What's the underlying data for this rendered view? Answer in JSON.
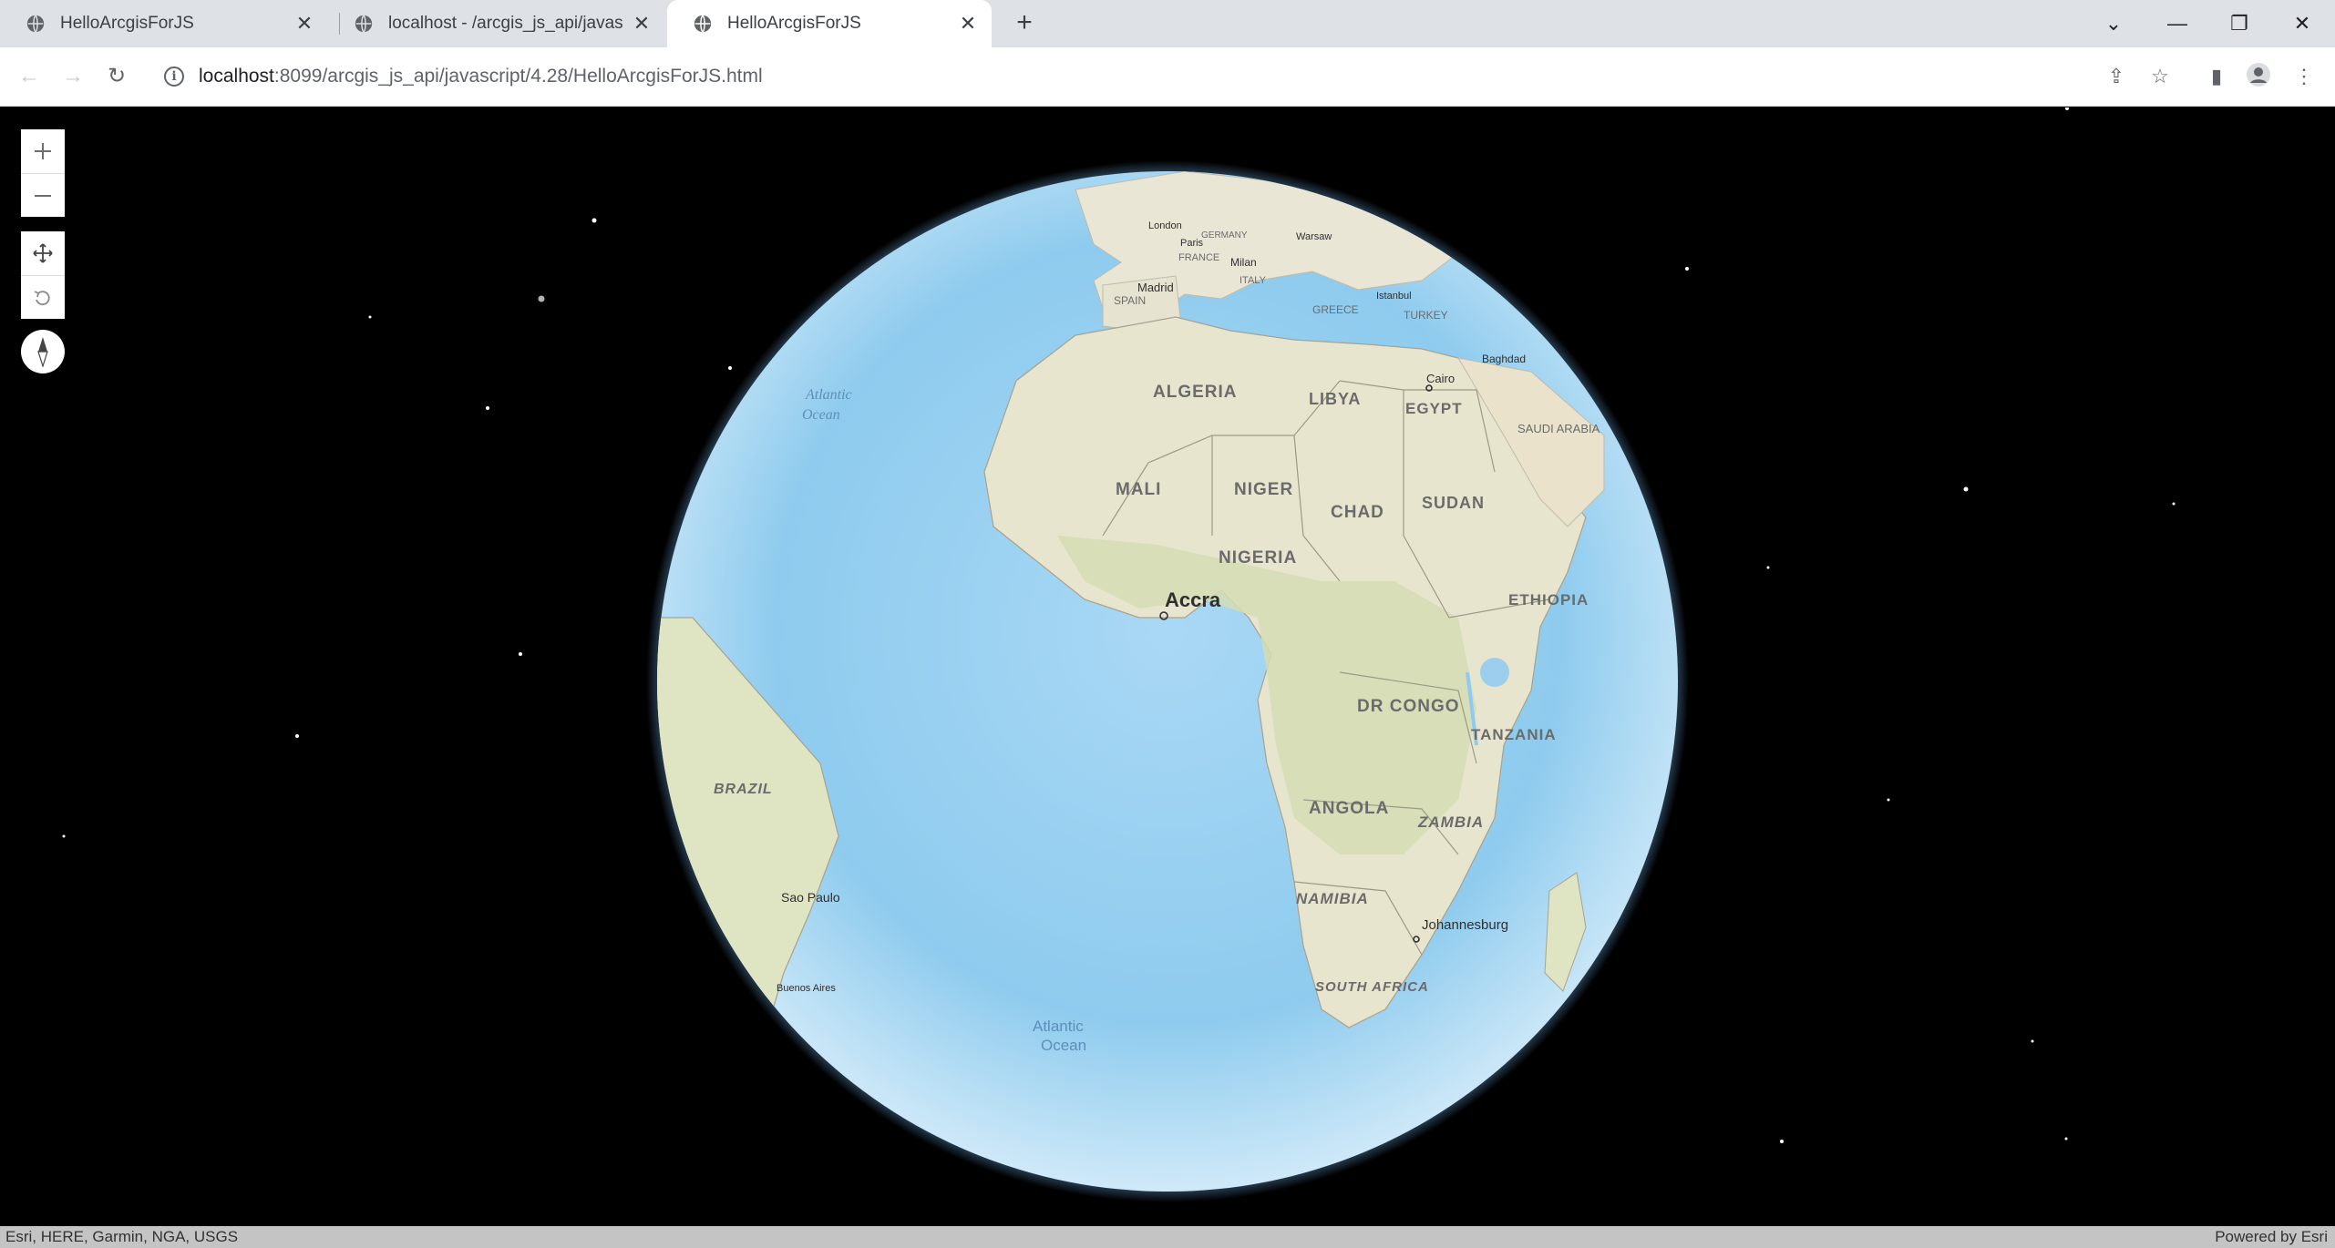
{
  "browser": {
    "tabs": [
      {
        "title": "HelloArcgisForJS",
        "active": false
      },
      {
        "title": "localhost - /arcgis_js_api/javas",
        "active": false
      },
      {
        "title": "HelloArcgisForJS",
        "active": true
      }
    ],
    "url_host": "localhost",
    "url_rest": ":8099/arcgis_js_api/javascript/4.28/HelloArcgisForJS.html"
  },
  "map": {
    "labels": {
      "algeria": "ALGERIA",
      "libya": "LIBYA",
      "egypt": "EGYPT",
      "mali": "MALI",
      "niger": "NIGER",
      "chad": "CHAD",
      "sudan": "SUDAN",
      "nigeria": "NIGERIA",
      "ethiopia": "ETHIOPIA",
      "accra": "Accra",
      "dr_congo": "DR CONGO",
      "tanzania": "TANZANIA",
      "angola": "ANGOLA",
      "zambia": "ZAMBIA",
      "namibia": "NAMIBIA",
      "johannesburg": "Johannesburg",
      "south_africa": "SOUTH AFRICA",
      "brazil": "BRAZIL",
      "sao_paulo": "Sao Paulo",
      "buenos_aires": "Buenos Aires",
      "atlantic_n_1": "Atlantic",
      "atlantic_n_2": "Ocean",
      "atlantic_s_1": "Atlantic",
      "atlantic_s_2": "Ocean",
      "madrid": "Madrid",
      "spain": "SPAIN",
      "france": "FRANCE",
      "italy": "ITALY",
      "milan": "Milan",
      "greece": "GREECE",
      "turkey": "TURKEY",
      "cairo": "Cairo",
      "saudi_arabia": "SAUDI ARABIA",
      "baghdad": "Baghdad",
      "paris": "Paris",
      "london": "London",
      "germany": "GERMANY",
      "warsaw": "Warsaw",
      "istanbul": "Istanbul"
    },
    "attribution": "Esri, HERE, Garmin, NGA, USGS",
    "powered_by": "Powered by Esri"
  }
}
